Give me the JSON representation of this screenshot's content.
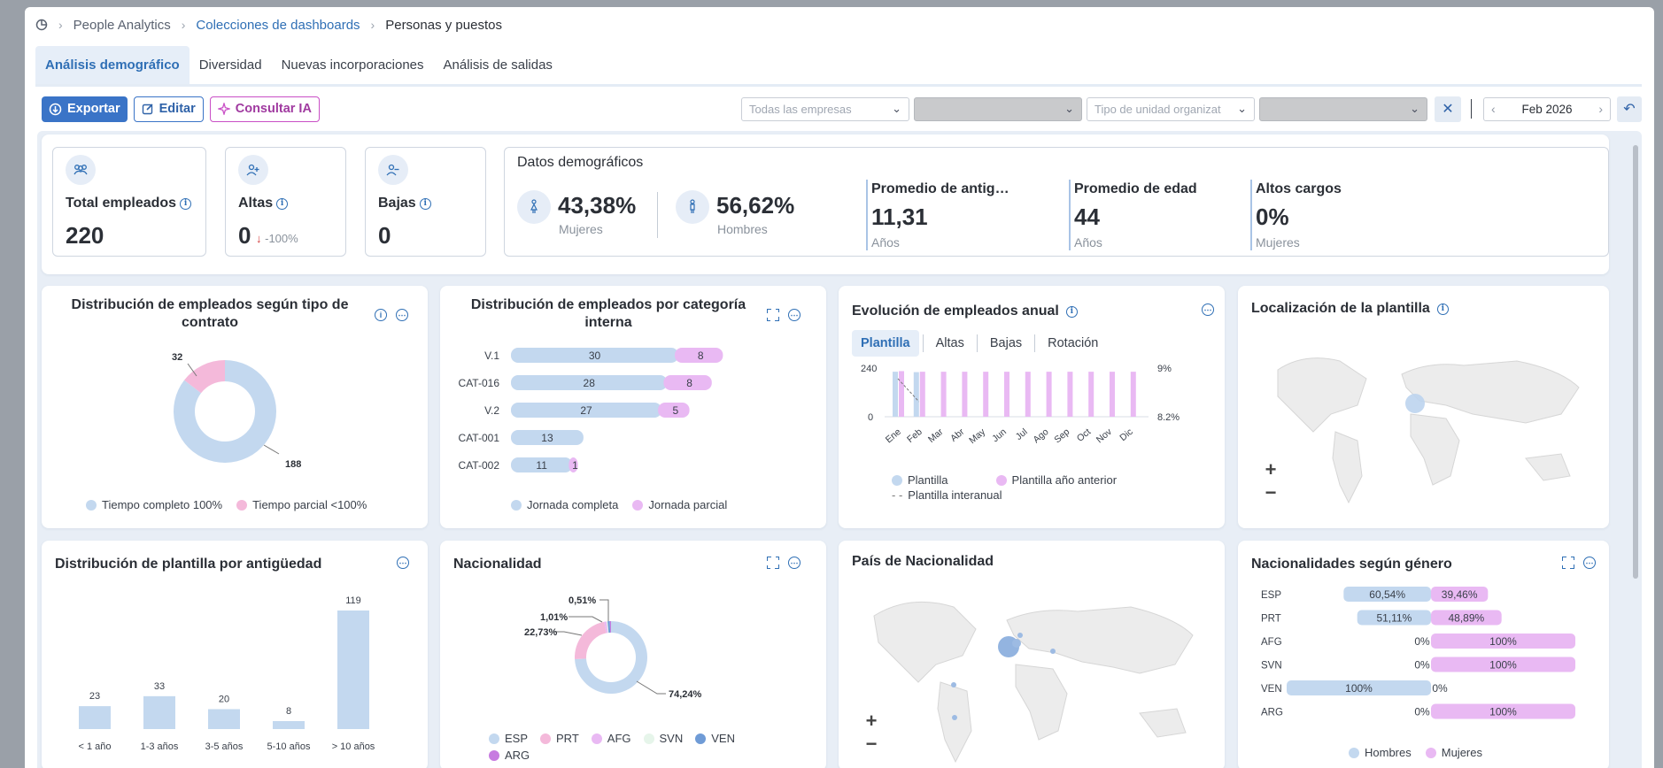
{
  "breadcrumb": {
    "items": [
      "People Analytics",
      "Colecciones de dashboards",
      "Personas y puestos"
    ]
  },
  "tabs": [
    "Análisis demográfico",
    "Diversidad",
    "Nuevas incorporaciones",
    "Análisis de salidas"
  ],
  "toolbar": {
    "export": "Exportar",
    "edit": "Editar",
    "ia": "Consultar IA"
  },
  "filters": {
    "empresas": "Todas las empresas",
    "tipo_unidad": "Tipo de unidad organizat",
    "date": "Feb 2026"
  },
  "kpis": {
    "total": {
      "title": "Total empleados",
      "value": "220"
    },
    "altas": {
      "title": "Altas",
      "value": "0",
      "delta": "-100%",
      "arrow": "↓"
    },
    "bajas": {
      "title": "Bajas",
      "value": "0"
    }
  },
  "demographics": {
    "title": "Datos demográficos",
    "women": {
      "value": "43,38%",
      "label": "Mujeres"
    },
    "men": {
      "value": "56,62%",
      "label": "Hombres"
    },
    "stats": [
      {
        "title": "Promedio de antigü...",
        "value": "11,31",
        "sub": "Años"
      },
      {
        "title": "Promedio de edad",
        "value": "44",
        "sub": "Años"
      },
      {
        "title": "Altos cargos",
        "value": "0%",
        "sub": "Mujeres"
      }
    ]
  },
  "contract": {
    "title_line1": "Distribución de empleados según tipo de",
    "title_line2": "contrato",
    "labels": {
      "small": "32",
      "large": "188"
    },
    "legend": [
      "Tiempo completo 100%",
      "Tiempo parcial <100%"
    ]
  },
  "category": {
    "title_line1": "Distribución de empleados por categoría",
    "title_line2": "interna",
    "legend": [
      "Jornada completa",
      "Jornada parcial"
    ]
  },
  "evolution": {
    "title": "Evolución de empleados anual",
    "subtabs": [
      "Plantilla",
      "Altas",
      "Bajas",
      "Rotación"
    ],
    "axis": {
      "yleft_top": "240",
      "yleft_bottom": "0",
      "yright_top": "9%",
      "yright_bottom": "8.2%"
    },
    "months": [
      "Ene",
      "Feb",
      "Mar",
      "Abr",
      "May",
      "Jun",
      "Jul",
      "Ago",
      "Sep",
      "Oct",
      "Nov",
      "Dic"
    ],
    "legend": [
      "Plantilla",
      "Plantilla año anterior",
      "Plantilla interanual"
    ]
  },
  "location": {
    "title": "Localización de la plantilla"
  },
  "seniority": {
    "title": "Distribución de plantilla por antigüedad"
  },
  "nationality": {
    "title": "Nacionalidad",
    "labels": {
      "a": "0,51%",
      "b": "1,01%",
      "c": "22,73%",
      "d": "74,24%"
    },
    "legend": [
      "ESP",
      "PRT",
      "AFG",
      "SVN",
      "VEN",
      "ARG"
    ]
  },
  "country": {
    "title": "País de Nacionalidad"
  },
  "gender_nat": {
    "title": "Nacionalidades según género",
    "legend": [
      "Hombres",
      "Mujeres"
    ]
  },
  "colors": {
    "blue": "#c3d8ef",
    "pink": "#f4b9da",
    "violet": "#e9b9f3",
    "accent": "#2f6fb5"
  },
  "chart_data": [
    {
      "type": "pie",
      "title": "Distribución de empleados según tipo de contrato",
      "categories": [
        "Tiempo completo 100%",
        "Tiempo parcial <100%"
      ],
      "values": [
        188,
        32
      ]
    },
    {
      "type": "bar",
      "title": "Distribución de empleados por categoría interna",
      "categories": [
        "V.1",
        "CAT-016",
        "V.2",
        "CAT-001",
        "CAT-002"
      ],
      "series": [
        {
          "name": "Jornada completa",
          "values": [
            30,
            28,
            27,
            13,
            11
          ]
        },
        {
          "name": "Jornada parcial",
          "values": [
            8,
            8,
            5,
            0,
            1
          ]
        }
      ]
    },
    {
      "type": "bar",
      "title": "Evolución de empleados anual",
      "categories": [
        "Ene",
        "Feb",
        "Mar",
        "Abr",
        "May",
        "Jun",
        "Jul",
        "Ago",
        "Sep",
        "Oct",
        "Nov",
        "Dic"
      ],
      "ylim": [
        0,
        240
      ],
      "series": [
        {
          "name": "Plantilla",
          "values": [
            222,
            220,
            null,
            null,
            null,
            null,
            null,
            null,
            null,
            null,
            null,
            null
          ]
        },
        {
          "name": "Plantilla año anterior",
          "values": [
            225,
            222,
            222,
            222,
            222,
            222,
            222,
            222,
            222,
            222,
            222,
            222
          ]
        }
      ]
    },
    {
      "type": "bar",
      "title": "Distribución de plantilla por antigüedad",
      "categories": [
        "< 1 año",
        "1-3 años",
        "3-5 años",
        "5-10 años",
        "> 10 años"
      ],
      "values": [
        23,
        33,
        20,
        8,
        119
      ]
    },
    {
      "type": "pie",
      "title": "Nacionalidad",
      "categories": [
        "ESP",
        "PRT",
        "AFG",
        "SVN",
        "VEN",
        "ARG"
      ],
      "values": [
        74.24,
        22.73,
        1.01,
        0.51,
        1.0,
        0.51
      ]
    },
    {
      "type": "bar",
      "title": "Nacionalidades según género",
      "categories": [
        "ESP",
        "PRT",
        "AFG",
        "SVN",
        "VEN",
        "ARG"
      ],
      "series": [
        {
          "name": "Hombres",
          "values": [
            60.54,
            51.11,
            0,
            0,
            100,
            0
          ],
          "labels": [
            "60,54%",
            "51,11%",
            "0%",
            "0%",
            "100%",
            "0%"
          ]
        },
        {
          "name": "Mujeres",
          "values": [
            39.46,
            48.89,
            100,
            100,
            0,
            100
          ],
          "labels": [
            "39,46%",
            "48,89%",
            "100%",
            "100%",
            "0%",
            "100%"
          ]
        }
      ]
    }
  ]
}
